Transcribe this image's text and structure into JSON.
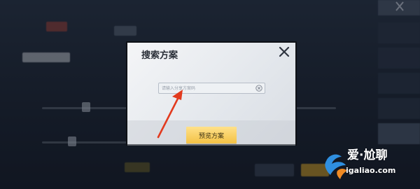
{
  "dialog": {
    "title": "搜索方案",
    "search_placeholder": "请输入分享方案码",
    "preview_button": "预览方案"
  },
  "watermark": {
    "brand": "爱·尬聊",
    "url": "igaliao.com"
  },
  "colors": {
    "dialog_bg": "#e9ecef",
    "button_yellow": "#f3c245",
    "arrow_red": "#e23a1e",
    "background": "#1b2230"
  }
}
